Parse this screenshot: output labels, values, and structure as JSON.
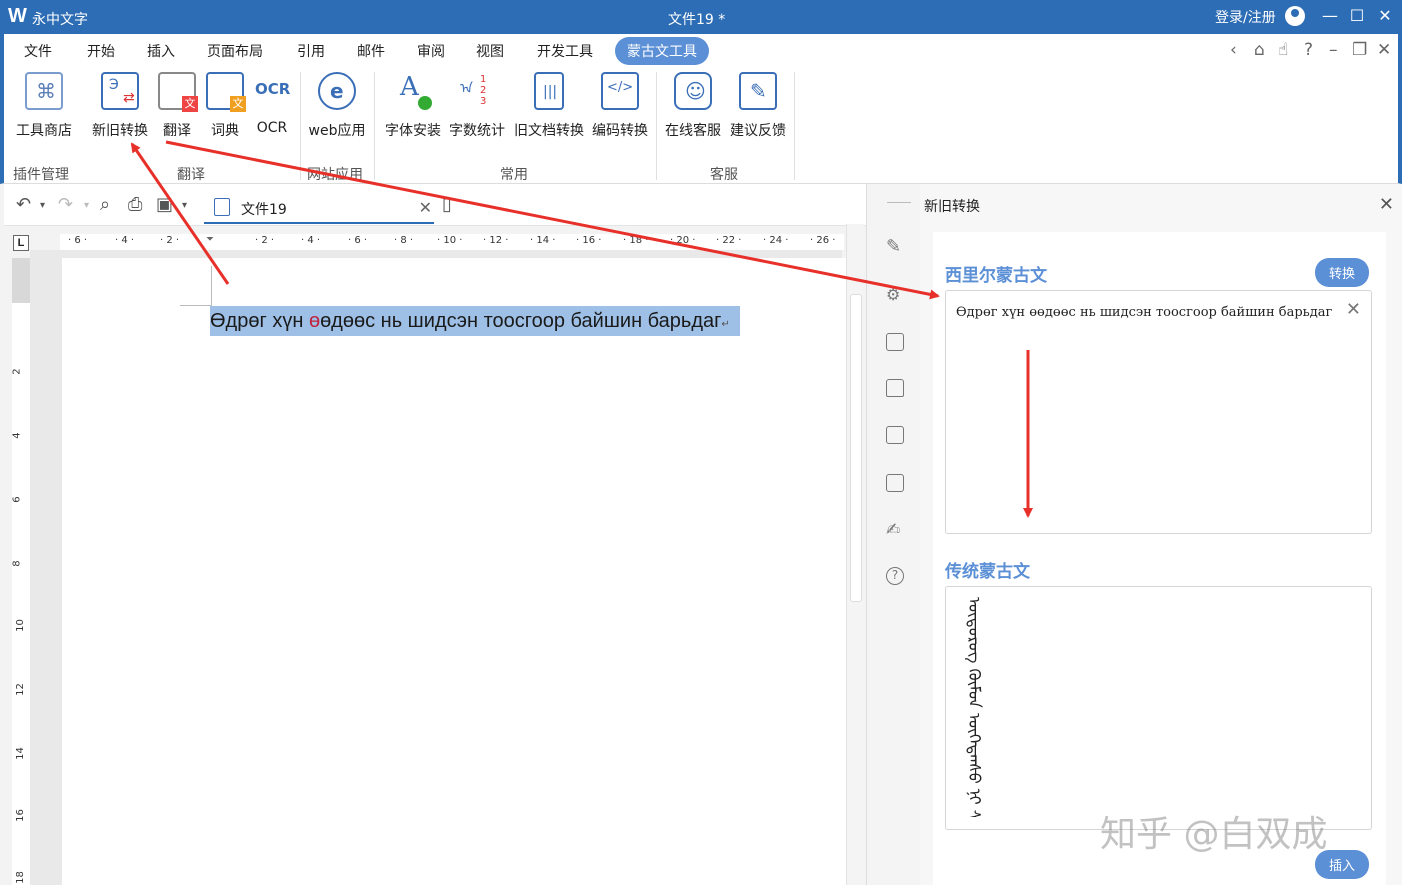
{
  "titlebar": {
    "app_name": "永中文字",
    "doc_title": "文件19 *",
    "login": "登录/注册"
  },
  "menu": {
    "tabs": [
      "文件",
      "开始",
      "插入",
      "页面布局",
      "引用",
      "邮件",
      "审阅",
      "视图",
      "开发工具",
      "蒙古文工具"
    ],
    "active": "蒙古文工具"
  },
  "ribbon": {
    "buttons": [
      {
        "label": "工具商店",
        "icon": "store-icon"
      },
      {
        "label": "新旧转换",
        "icon": "convert-icon"
      },
      {
        "label": "翻译",
        "icon": "translate-icon"
      },
      {
        "label": "词典",
        "icon": "dictionary-icon"
      },
      {
        "label": "OCR",
        "icon": "ocr-icon"
      },
      {
        "label": "web应用",
        "icon": "web-app-icon"
      },
      {
        "label": "字体安装",
        "icon": "font-install-icon"
      },
      {
        "label": "字数统计",
        "icon": "word-count-icon"
      },
      {
        "label": "旧文档转换",
        "icon": "old-doc-convert-icon"
      },
      {
        "label": "编码转换",
        "icon": "encoding-convert-icon"
      },
      {
        "label": "在线客服",
        "icon": "online-service-icon"
      },
      {
        "label": "建议反馈",
        "icon": "feedback-icon"
      }
    ],
    "groups": [
      "插件管理",
      "翻译",
      "网站应用",
      "常用",
      "客服"
    ]
  },
  "doc_tab": {
    "name": "文件19"
  },
  "ruler": {
    "h_ticks": [
      "6",
      "4",
      "2",
      "2",
      "4",
      "6",
      "8",
      "10",
      "12",
      "14",
      "16",
      "18",
      "20",
      "22",
      "24",
      "26"
    ],
    "v_ticks": [
      "2",
      "4",
      "6",
      "8",
      "10",
      "12",
      "14",
      "16",
      "18"
    ],
    "l_label": "L"
  },
  "document": {
    "text_a": "Өдрөг хүн  ",
    "text_red": "ө",
    "text_b": "өдөөс нь шидсэн тоосгоор байшин барьдаг",
    "para_mark": "↵"
  },
  "panel": {
    "title": "新旧转换",
    "source_title": "西里尔蒙古文",
    "convert_button": "转换",
    "source_text": "Өдрөг хүн өөдөөс нь шидсэн тоосгоор байшин барьдаг",
    "target_title": "传统蒙古文",
    "target_text": "ᠦᠳᠦᠷᠦᠭ ᠬᠦᠮᠦᠨ ᠥᠭᠡᠳᠡᠡᠰᠦ ᠨᠢ ᠰᠢᠳᠬᠡᠭᠰᠡᠨ ᠲᠣᠭᠤᠰᠭᠠᠷ ᠪᠠᠢᠰᠢᠩ ᠪᠠᠷᠢᠳᠠᠭ",
    "insert_button": "插入"
  },
  "watermark": "知乎 @白双成",
  "colors": {
    "accent": "#2d6db5",
    "panel_accent": "#5b8fd6",
    "arrow": "#e8302a"
  }
}
